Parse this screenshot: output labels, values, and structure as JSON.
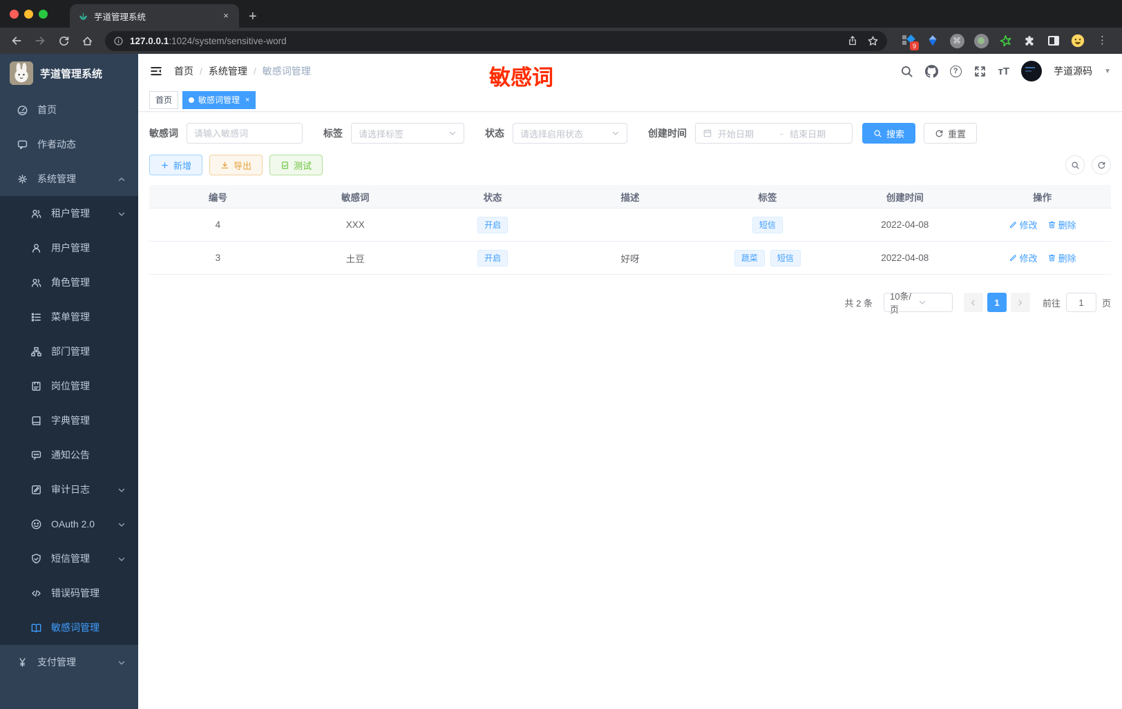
{
  "browser": {
    "traffic_lights": [
      "#ff5f57",
      "#febc2e",
      "#28c840"
    ],
    "tab_title": "芋道管理系统",
    "tab_close": "×",
    "new_tab": "+",
    "url_host": "127.0.0.1",
    "url_path": ":1024/system/sensitive-word",
    "extension_badge": "9",
    "menu_dots": "⋮"
  },
  "sidebar": {
    "logo_title": "芋道管理系统",
    "items": [
      {
        "key": "home",
        "icon": "gauge-icon",
        "label": "首页",
        "level": 1
      },
      {
        "key": "author-feed",
        "icon": "chat-icon",
        "label": "作者动态",
        "level": 1
      },
      {
        "key": "system",
        "icon": "gear-icon",
        "label": "系统管理",
        "level": 1,
        "chevron": "up"
      },
      {
        "key": "tenant",
        "icon": "users-icon",
        "label": "租户管理",
        "level": 2,
        "chevron": "down"
      },
      {
        "key": "user",
        "icon": "user-icon",
        "label": "用户管理",
        "level": 2
      },
      {
        "key": "role",
        "icon": "users-icon",
        "label": "角色管理",
        "level": 2
      },
      {
        "key": "menu",
        "icon": "tree-icon",
        "label": "菜单管理",
        "level": 2
      },
      {
        "key": "dept",
        "icon": "org-icon",
        "label": "部门管理",
        "level": 2
      },
      {
        "key": "post",
        "icon": "badge-icon",
        "label": "岗位管理",
        "level": 2
      },
      {
        "key": "dict",
        "icon": "book-icon",
        "label": "字典管理",
        "level": 2
      },
      {
        "key": "notice",
        "icon": "comment-icon",
        "label": "通知公告",
        "level": 2
      },
      {
        "key": "audit-log",
        "icon": "log-icon",
        "label": "审计日志",
        "level": 2,
        "chevron": "down"
      },
      {
        "key": "oauth",
        "icon": "robot-icon",
        "label": "OAuth 2.0",
        "level": 2,
        "chevron": "down"
      },
      {
        "key": "sms",
        "icon": "shield-icon",
        "label": "短信管理",
        "level": 2,
        "chevron": "down"
      },
      {
        "key": "error-code",
        "icon": "code-icon",
        "label": "错误码管理",
        "level": 2
      },
      {
        "key": "sensitive-word",
        "icon": "openbook-icon",
        "label": "敏感词管理",
        "level": 2,
        "active": true
      },
      {
        "key": "pay",
        "icon": "yen-icon",
        "label": "支付管理",
        "level": 1,
        "chevron": "down"
      }
    ]
  },
  "navbar": {
    "breadcrumb": [
      "首页",
      "系统管理",
      "敏感词管理"
    ],
    "annotation": "敏感词",
    "username": "芋道源码"
  },
  "tags_view": [
    {
      "label": "首页",
      "active": false,
      "closable": false
    },
    {
      "label": "敏感词管理",
      "active": true,
      "closable": true
    }
  ],
  "filters": {
    "word": {
      "label": "敏感词",
      "placeholder": "请输入敏感词"
    },
    "tag": {
      "label": "标签",
      "placeholder": "请选择标签"
    },
    "status": {
      "label": "状态",
      "placeholder": "请选择启用状态"
    },
    "created": {
      "label": "创建时间",
      "start_placeholder": "开始日期",
      "separator": "-",
      "end_placeholder": "结束日期"
    },
    "search_label": "搜索",
    "reset_label": "重置"
  },
  "toolbar": {
    "add_label": "新增",
    "export_label": "导出",
    "test_label": "测试"
  },
  "table": {
    "headers": [
      "编号",
      "敏感词",
      "状态",
      "描述",
      "标签",
      "创建时间",
      "操作"
    ],
    "rows": [
      {
        "id": "4",
        "word": "XXX",
        "status": "开启",
        "description": "",
        "tags": [
          "短信"
        ],
        "created": "2022-04-08"
      },
      {
        "id": "3",
        "word": "土豆",
        "status": "开启",
        "description": "好呀",
        "tags": [
          "蔬菜",
          "短信"
        ],
        "created": "2022-04-08"
      }
    ],
    "edit_label": "修改",
    "delete_label": "删除"
  },
  "pagination": {
    "total": "共 2 条",
    "page_size": "10条/页",
    "current_page": "1",
    "goto_label": "前往",
    "goto_value": "1",
    "page_unit": "页"
  },
  "colors": {
    "primary": "#409eff",
    "warning": "#e6a23c",
    "success": "#67c23a",
    "annotation_red": "#ff2d00",
    "sidebar_bg": "#304156",
    "sidebar_sub_bg": "#1f2d3d"
  }
}
